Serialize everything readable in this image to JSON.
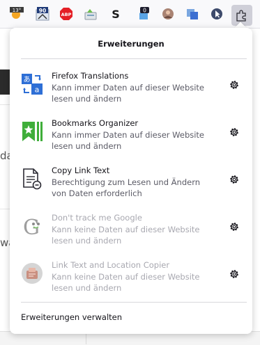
{
  "toolbar": {
    "badges": {
      "weather": "13°",
      "counter": "90",
      "adblock": "ABP",
      "notifications": "0"
    },
    "icons": [
      "weather-icon",
      "calendar-counter-icon",
      "adblock-icon",
      "bookmark-cleaner-icon",
      "s-extension-icon",
      "notification-icon",
      "avatar-icon",
      "translate-page-icon",
      "cursor-icon",
      "extensions-puzzle-icon"
    ]
  },
  "background": {
    "text_1": "da",
    "text_2": "wa"
  },
  "panel": {
    "title": "Erweiterungen",
    "extensions": [
      {
        "name": "Firefox Translations",
        "description": "Kann immer Daten auf dieser Website lesen und ändern",
        "icon": "translations-icon",
        "enabled": true
      },
      {
        "name": "Bookmarks Organizer",
        "description": "Kann immer Daten auf dieser Website lesen und ändern",
        "icon": "bookmarks-organizer-icon",
        "enabled": true
      },
      {
        "name": "Copy Link Text",
        "description": "Berechtigung zum Lesen und Ändern von Daten erforderlich",
        "icon": "copy-link-text-icon",
        "enabled": true
      },
      {
        "name": "Don't track me Google",
        "description": "Kann keine Daten auf dieser Website lesen und ändern",
        "icon": "dont-track-google-icon",
        "enabled": false
      },
      {
        "name": "Link Text and Location Copier",
        "description": "Kann keine Daten auf dieser Website lesen und ändern",
        "icon": "link-copier-icon",
        "enabled": false
      }
    ],
    "manage_label": "Erweiterungen verwalten"
  },
  "colors": {
    "accent": "#0061e0",
    "panel_bg": "#ffffff",
    "text": "#15141a",
    "muted": "#5b5b66",
    "disabled": "#a8a8b0"
  }
}
